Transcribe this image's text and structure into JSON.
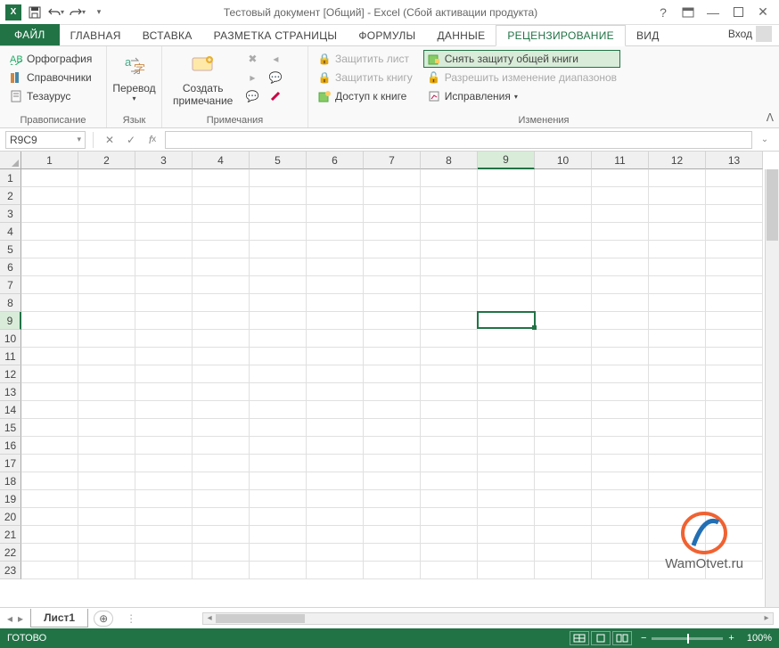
{
  "title": "Тестовый документ  [Общий] - Excel (Сбой активации продукта)",
  "signin": "Вход",
  "tabs": {
    "file": "ФАЙЛ",
    "home": "ГЛАВНАЯ",
    "insert": "ВСТАВКА",
    "pagelayout": "РАЗМЕТКА СТРАНИЦЫ",
    "formulas": "ФОРМУЛЫ",
    "data": "ДАННЫЕ",
    "review": "РЕЦЕНЗИРОВАНИЕ",
    "view": "ВИД"
  },
  "ribbon": {
    "proofing": {
      "spelling": "Орфография",
      "research": "Справочники",
      "thesaurus": "Тезаурус",
      "label": "Правописание"
    },
    "language": {
      "translate": "Перевод",
      "label": "Язык"
    },
    "comments": {
      "new": "Создать\nпримечание",
      "label": "Примечания"
    },
    "changes": {
      "protectsheet": "Защитить лист",
      "protectbook": "Защитить книгу",
      "sharebook": "Доступ к книге",
      "unshare": "Снять защиту общей книги",
      "allowranges": "Разрешить изменение диапазонов",
      "track": "Исправления",
      "label": "Изменения"
    }
  },
  "namebox": "R9C9",
  "formula": "",
  "cols": [
    "1",
    "2",
    "3",
    "4",
    "5",
    "6",
    "7",
    "8",
    "9",
    "10",
    "11",
    "12",
    "13"
  ],
  "rows": [
    "1",
    "2",
    "3",
    "4",
    "5",
    "6",
    "7",
    "8",
    "9",
    "10",
    "11",
    "12",
    "13",
    "14",
    "15",
    "16",
    "17",
    "18",
    "19",
    "20",
    "21",
    "22",
    "23"
  ],
  "selected": {
    "row": 9,
    "col": 9
  },
  "sheet": {
    "name": "Лист1"
  },
  "status": {
    "ready": "ГОТОВО",
    "zoom": "100%"
  },
  "watermark": "WamOtvet.ru"
}
